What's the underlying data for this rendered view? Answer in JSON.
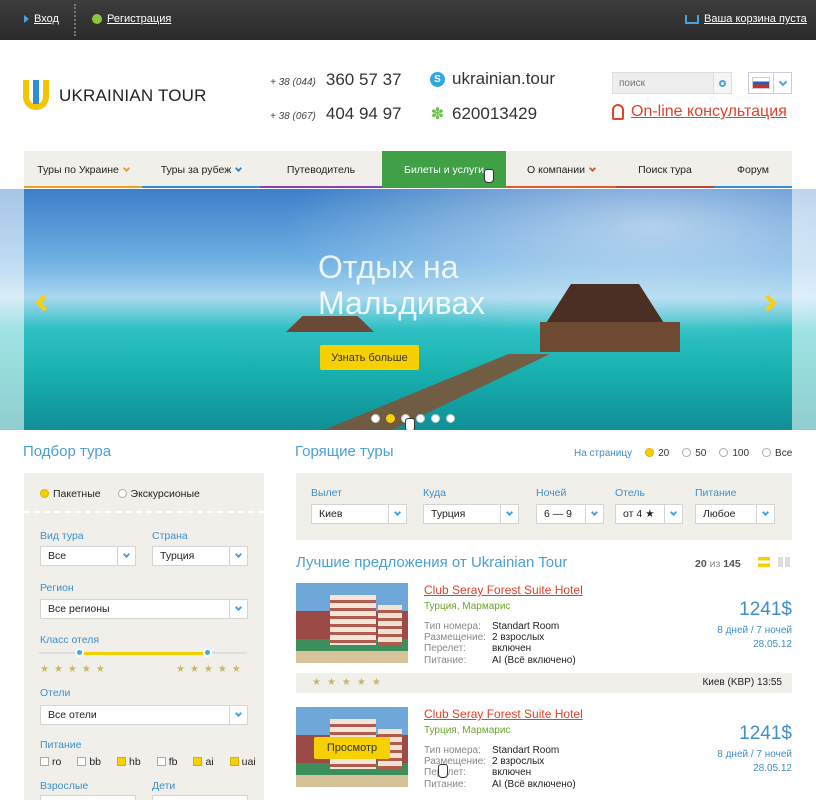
{
  "topbar": {
    "login": "Вход",
    "register": "Регистрация",
    "cart": "Ваша корзина пуста"
  },
  "header": {
    "logo_text": "UKRAINIAN TOUR",
    "phones": [
      {
        "code": "+ 38 (044)",
        "number": "360 57 37"
      },
      {
        "code": "+ 38 (067)",
        "number": "404 94 97"
      }
    ],
    "skype": "ukrainian.tour",
    "icq": "620013429",
    "search_placeholder": "поиск",
    "consult": "On-line консультация"
  },
  "nav": [
    {
      "label": "Туры по Украине",
      "dropdown": true,
      "accent": "#f0a01a"
    },
    {
      "label": "Туры за рубеж",
      "dropdown": true,
      "accent": "#2e8fd6"
    },
    {
      "label": "Путеводитель",
      "dropdown": false,
      "accent": "#8c3fb0"
    },
    {
      "label": "Билеты и услуги",
      "dropdown": false,
      "accent": "#3fa046",
      "active": true
    },
    {
      "label": "О компании",
      "dropdown": true,
      "accent": "#e25a2a"
    },
    {
      "label": "Поиск тура",
      "dropdown": false,
      "accent": "#b5473a"
    },
    {
      "label": "Форум",
      "dropdown": false,
      "accent": "#2e8fd6"
    }
  ],
  "hero": {
    "title": "Отдых на Мальдивах",
    "button": "Узнать больше",
    "slides": 6,
    "active_slide": 2
  },
  "tour_search": {
    "title": "Подбор тура",
    "type_options": [
      "Пакетные",
      "Экскурсионые"
    ],
    "tour_type_label": "Вид тура",
    "tour_type_value": "Все",
    "country_label": "Страна",
    "country_value": "Турция",
    "region_label": "Регион",
    "region_value": "Все регионы",
    "hotel_class_label": "Класс отеля",
    "hotels_label": "Отели",
    "hotels_value": "Все отели",
    "food_label": "Питание",
    "food_options": [
      {
        "label": "ro",
        "checked": false
      },
      {
        "label": "bb",
        "checked": false
      },
      {
        "label": "hb",
        "checked": true
      },
      {
        "label": "fb",
        "checked": false
      },
      {
        "label": "ai",
        "checked": true
      },
      {
        "label": "uai",
        "checked": true
      }
    ],
    "adults_label": "Взрослые",
    "children_label": "Дети"
  },
  "hot_tours": {
    "title": "Горящие туры",
    "per_page_label": "На страницу",
    "per_page_options": [
      "20",
      "50",
      "100",
      "Все"
    ],
    "filters": [
      {
        "label": "Вылет",
        "value": "Киев"
      },
      {
        "label": "Куда",
        "value": "Турция"
      },
      {
        "label": "Ночей",
        "value": "6 — 9"
      },
      {
        "label": "Отель",
        "value": "от 4 ★"
      },
      {
        "label": "Питание",
        "value": "Любое"
      }
    ]
  },
  "best": {
    "title": "Лучшие предложения от Ukrainian Tour",
    "count_shown": "20",
    "count_of": "из",
    "count_total": "145",
    "offers": [
      {
        "name": "Club Seray Forest Suite Hotel",
        "location": "Турция, Мармарис",
        "room_label": "Тип номера:",
        "room": "Standart Room",
        "place_label": "Размещение:",
        "place": "2 взрослых",
        "flight_label": "Перелет:",
        "flight": "включен",
        "food_label": "Питание:",
        "food": "AI (Всё включено)",
        "price": "1241$",
        "duration": "8 дней / 7 ночей",
        "date": "28.05.12",
        "departure": "Киев (KBP) 13:55"
      },
      {
        "name": "Club Seray Forest Suite Hotel",
        "location": "Турция, Мармарис",
        "room_label": "Тип номера:",
        "room": "Standart Room",
        "place_label": "Размещение:",
        "place": "2 взрослых",
        "flight_label": "Перелет:",
        "flight": "включен",
        "food_label": "Питание:",
        "food": "AI (Всё включено)",
        "price": "1241$",
        "duration": "8 дней / 7 ночей",
        "date": "28.05.12",
        "view_button": "Просмотр"
      }
    ]
  }
}
